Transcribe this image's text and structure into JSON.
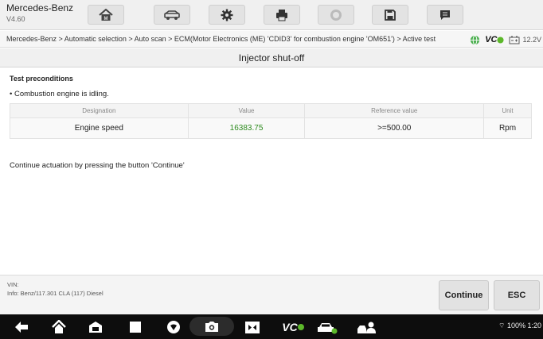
{
  "app": {
    "name": "Mercedes-Benz",
    "version": "V4.60"
  },
  "toolbar": {
    "icons": [
      "home-icon",
      "vehicle-icon",
      "settings-icon",
      "printer-icon",
      "help-icon",
      "save-icon",
      "message-icon"
    ]
  },
  "breadcrumb": {
    "path": "Mercedes-Benz > Automatic selection > Auto scan > ECM(Motor Electronics (ME) 'CDID3' for combustion engine 'OM651') > Active test",
    "vc_label": "VC",
    "voltage": "12.2V"
  },
  "page": {
    "title": "Injector shut-off",
    "section_heading": "Test preconditions",
    "precondition": "• Combustion engine is idling.",
    "table": {
      "headers": [
        "Designation",
        "Value",
        "Reference value",
        "Unit"
      ],
      "rows": [
        {
          "designation": "Engine speed",
          "value": "16383.75",
          "reference": ">=500.00",
          "unit": "Rpm"
        }
      ]
    },
    "instruction": "Continue actuation by pressing the button 'Continue'"
  },
  "footer": {
    "vin_label": "VIN:",
    "info": "Info: Benz/117.301 CLA (117) Diesel",
    "continue_label": "Continue",
    "esc_label": "ESC"
  },
  "navbar": {
    "vc_label": "VC",
    "status_text": "100% 1:20"
  },
  "colors": {
    "value_green": "#2e8b1f",
    "vc_green": "#5cb82a"
  }
}
